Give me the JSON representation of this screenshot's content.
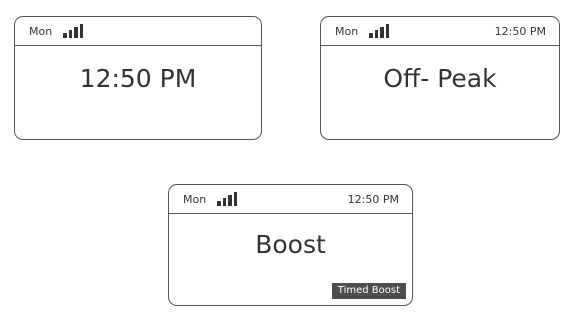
{
  "screens": [
    {
      "day": "Mon",
      "signal_icon": "signal-strength-icon",
      "status_time": "",
      "main": "12:50 PM",
      "tag": ""
    },
    {
      "day": "Mon",
      "signal_icon": "signal-strength-icon",
      "status_time": "12:50 PM",
      "main": "Off- Peak",
      "tag": ""
    },
    {
      "day": "Mon",
      "signal_icon": "signal-strength-icon",
      "status_time": "12:50 PM",
      "main": "Boost",
      "tag": "Timed Boost"
    }
  ],
  "colors": {
    "outline": "#555555",
    "text": "#333333",
    "tag_background": "#4d4d4d",
    "tag_text": "#ffffff"
  }
}
